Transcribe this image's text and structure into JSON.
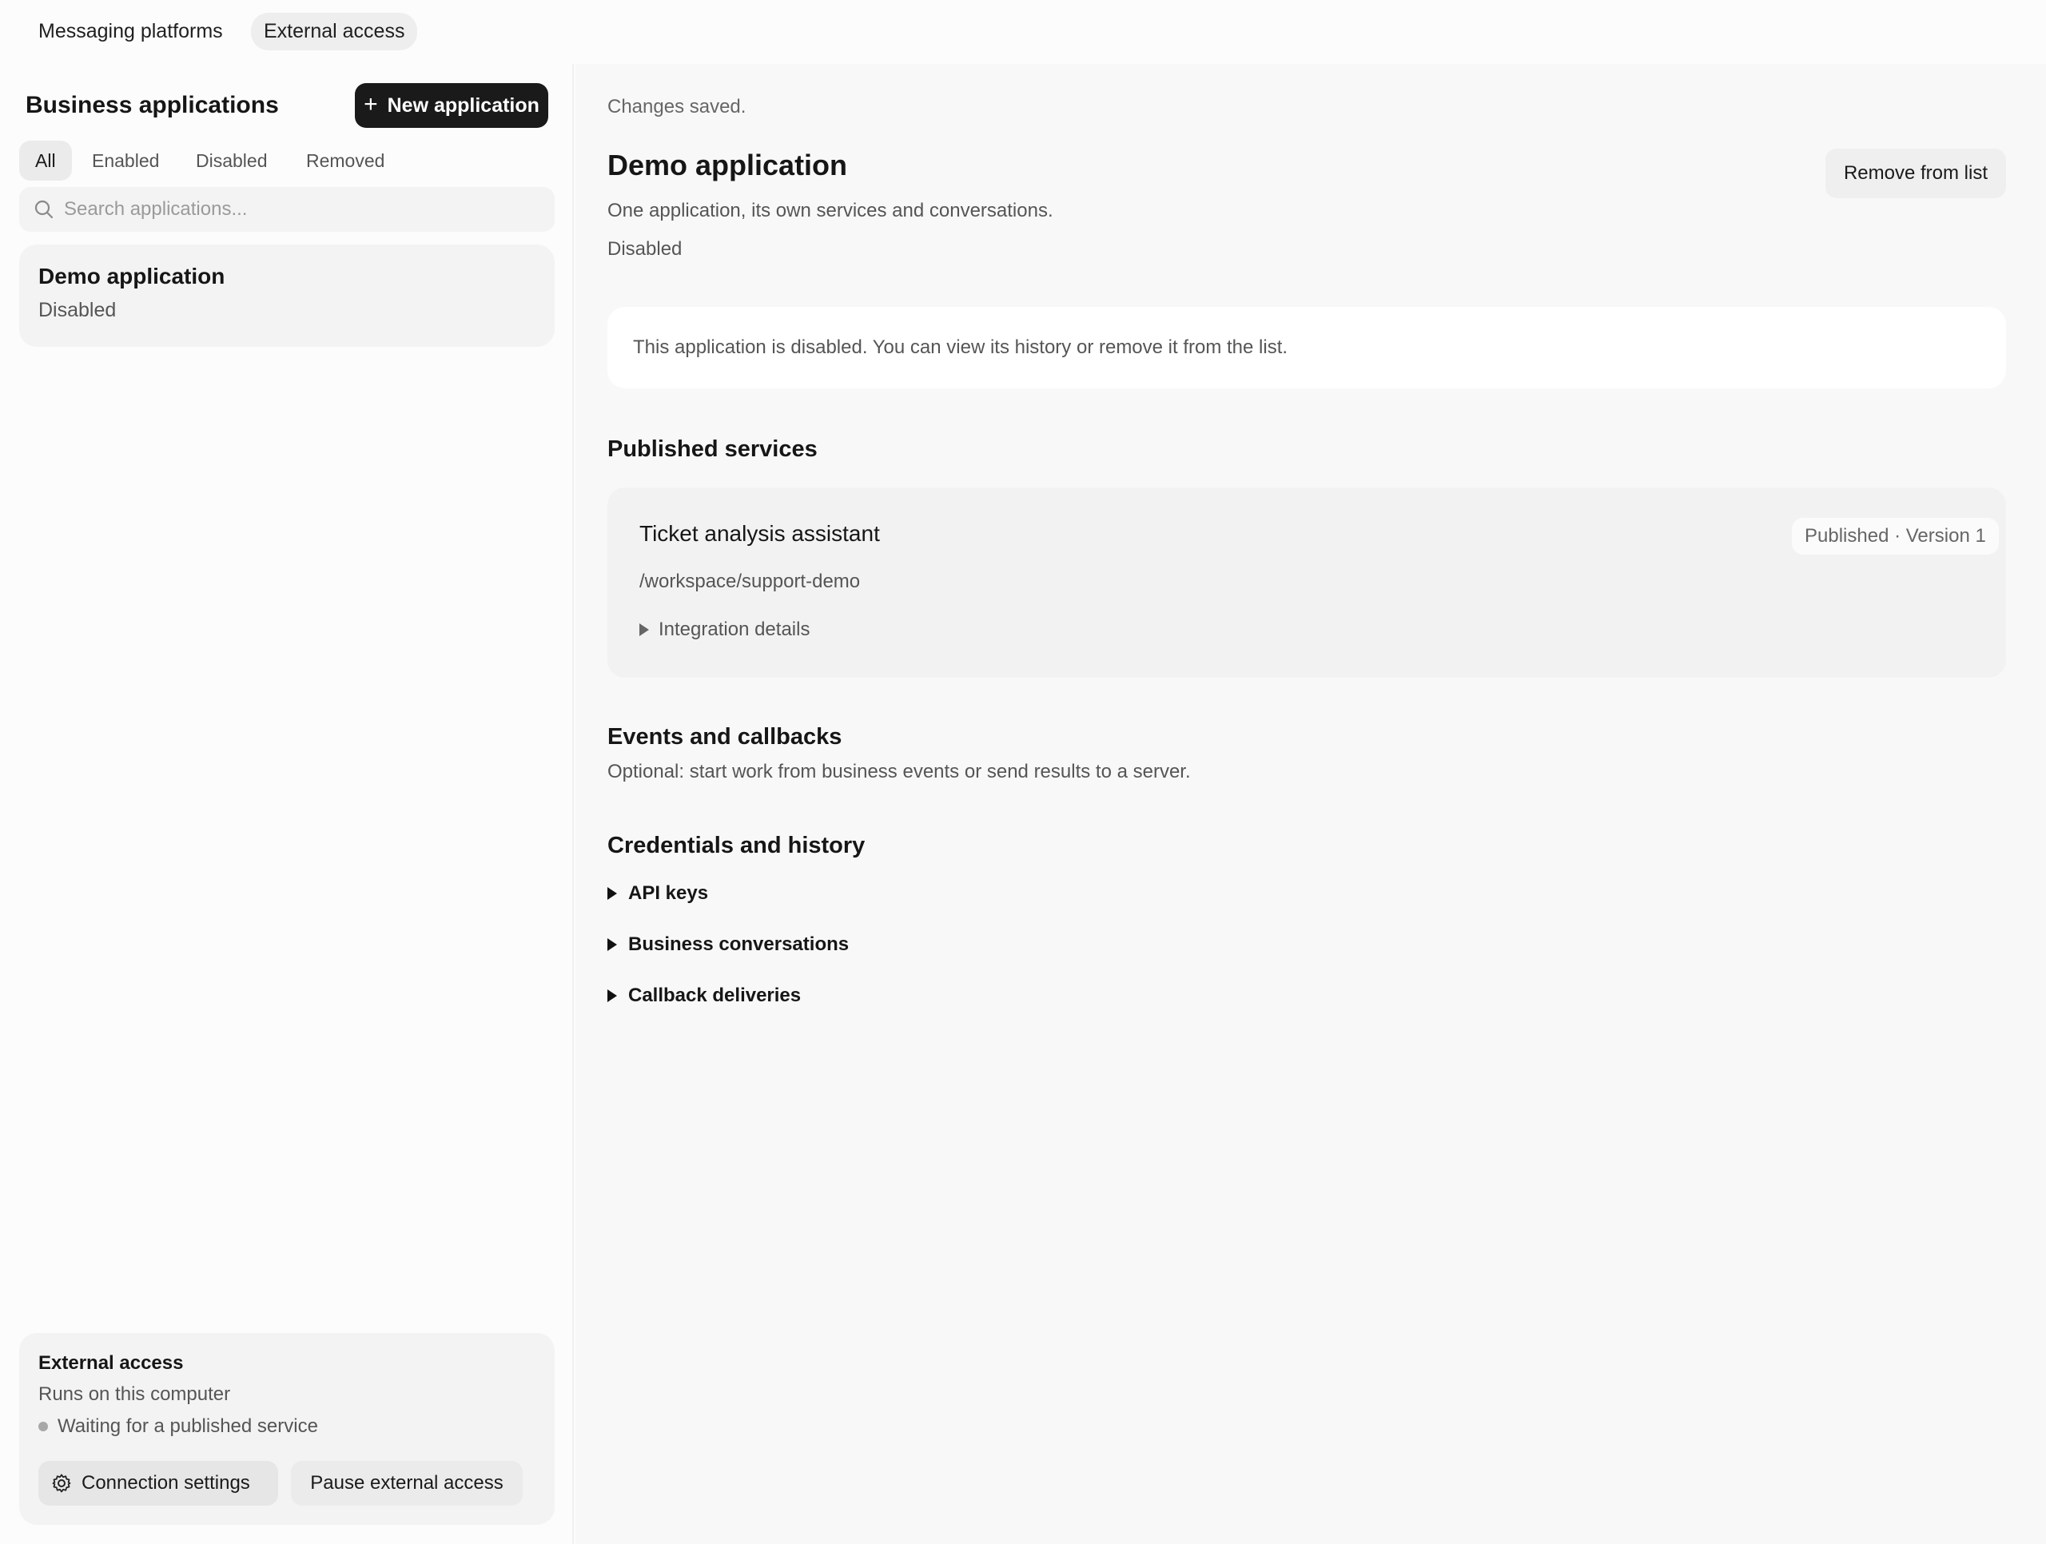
{
  "top_tabs": [
    {
      "label": "Messaging platforms"
    },
    {
      "label": "External access"
    }
  ],
  "sidebar": {
    "title": "Business applications",
    "new_button": "New application",
    "filters": [
      {
        "label": "All"
      },
      {
        "label": "Enabled"
      },
      {
        "label": "Disabled"
      },
      {
        "label": "Removed"
      }
    ],
    "search": {
      "placeholder": "Search applications...",
      "value": ""
    },
    "apps": [
      {
        "name": "Demo application",
        "status": "Disabled"
      }
    ],
    "external_access": {
      "title": "External access",
      "subtitle": "Runs on this computer",
      "status": "Waiting for a published service",
      "connection_button": "Connection settings",
      "pause_button": "Pause external access"
    }
  },
  "main": {
    "save_status": "Changes saved.",
    "title": "Demo application",
    "description": "One application, its own services and conversations.",
    "status": "Disabled",
    "remove_button": "Remove from list",
    "notice": "This application is disabled. You can view its history or remove it from the list.",
    "published_services": {
      "title": "Published services",
      "items": [
        {
          "name": "Ticket analysis assistant",
          "path": "/workspace/support-demo",
          "badge": "Published · Version 1",
          "details_label": "Integration details"
        }
      ]
    },
    "events": {
      "title": "Events and callbacks",
      "description": "Optional: start work from business events or send results to a server."
    },
    "credentials": {
      "title": "Credentials and history",
      "sections": [
        {
          "label": "API keys"
        },
        {
          "label": "Business conversations"
        },
        {
          "label": "Callback deliveries"
        }
      ]
    }
  },
  "icons": {
    "search": "search-icon",
    "gear": "gear-icon",
    "plus": "plus-icon",
    "disclosure": "triangle-right-icon"
  },
  "colors": {
    "primary_button": "#1a1a1a",
    "status_dot": "#a8a8a8"
  }
}
